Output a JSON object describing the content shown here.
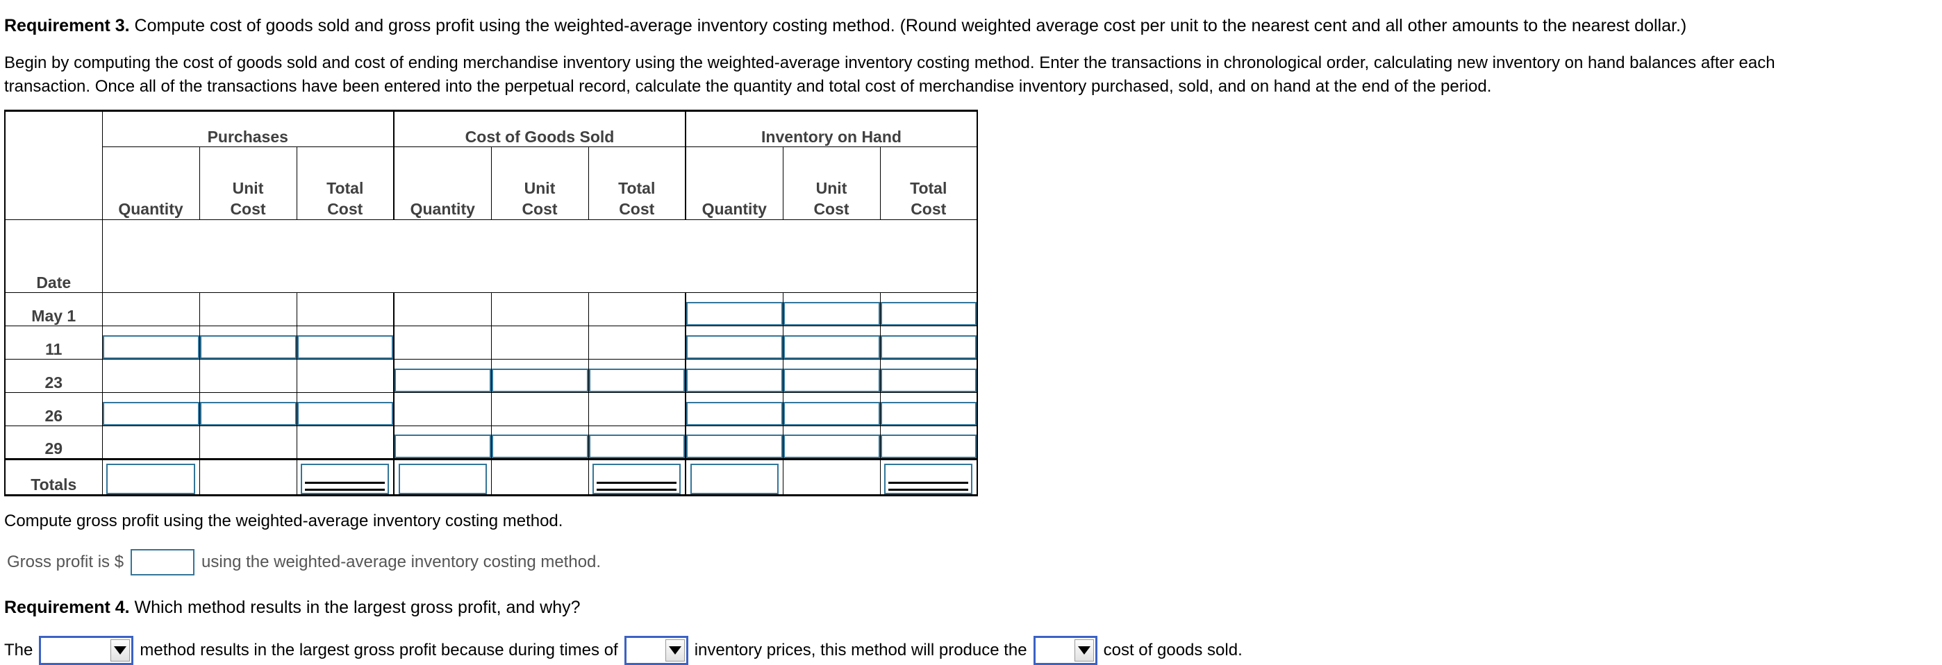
{
  "requirement3": {
    "label": "Requirement 3.",
    "text": " Compute cost of goods sold and gross profit using the weighted-average inventory costing method. (Round weighted average cost per unit to the nearest cent and all other amounts to the nearest dollar.)"
  },
  "instructions": {
    "line1": "Begin by computing the cost of goods sold and cost of ending merchandise inventory using the weighted-average inventory costing method. Enter the transactions in chronological order, calculating new inventory on hand balances after each",
    "line2": "transaction. Once all of the transactions have been entered into the perpetual record, calculate the quantity and total cost of merchandise inventory purchased, sold, and on hand at the end of the period."
  },
  "table": {
    "group_headers": [
      "Purchases",
      "Cost of Goods Sold",
      "Inventory on Hand"
    ],
    "date_header": "Date",
    "sub_headers": {
      "quantity": "Quantity",
      "unit_cost_l1": "Unit",
      "unit_cost_l2": "Cost",
      "total_cost_l1": "Total",
      "total_cost_l2": "Cost"
    },
    "totals_label": "Totals",
    "rows": [
      {
        "date": "May 1",
        "purch": [
          false,
          false,
          false
        ],
        "cogs": [
          false,
          false,
          false
        ],
        "inv": [
          true,
          true,
          true
        ]
      },
      {
        "date": "11",
        "purch": [
          true,
          true,
          true
        ],
        "cogs": [
          false,
          false,
          false
        ],
        "inv": [
          true,
          true,
          true
        ]
      },
      {
        "date": "23",
        "purch": [
          false,
          false,
          false
        ],
        "cogs": [
          true,
          true,
          true
        ],
        "inv": [
          true,
          true,
          true
        ]
      },
      {
        "date": "26",
        "purch": [
          true,
          true,
          true
        ],
        "cogs": [
          false,
          false,
          false
        ],
        "inv": [
          true,
          true,
          true
        ]
      },
      {
        "date": "29",
        "purch": [
          false,
          false,
          false
        ],
        "cogs": [
          true,
          true,
          true
        ],
        "inv": [
          true,
          true,
          true
        ]
      }
    ],
    "totals": {
      "purch": [
        {
          "input": true,
          "double_rule": false
        },
        {
          "input": false,
          "double_rule": false
        },
        {
          "input": true,
          "double_rule": true
        }
      ],
      "cogs": [
        {
          "input": true,
          "double_rule": false
        },
        {
          "input": false,
          "double_rule": false
        },
        {
          "input": true,
          "double_rule": true
        }
      ],
      "inv": [
        {
          "input": true,
          "double_rule": false
        },
        {
          "input": false,
          "double_rule": false
        },
        {
          "input": true,
          "double_rule": true
        }
      ]
    }
  },
  "gross_profit": {
    "heading": "Compute gross profit using the weighted-average inventory costing method.",
    "prefix": "Gross profit is $",
    "value": "",
    "suffix": "using the weighted-average inventory costing method."
  },
  "requirement4": {
    "label": "Requirement 4.",
    "text": " Which method results in the largest gross profit, and why?",
    "sentence": {
      "p1": "The",
      "select1": "",
      "p2": "method results in the largest gross profit because during times of",
      "select2": "",
      "p3": "inventory prices, this method will produce the",
      "select3": "",
      "p4": "cost of goods sold."
    }
  },
  "colors": {
    "input_border": "#337599",
    "select_border": "#3b62c4",
    "header_text": "#404040",
    "body_text": "#000000"
  }
}
